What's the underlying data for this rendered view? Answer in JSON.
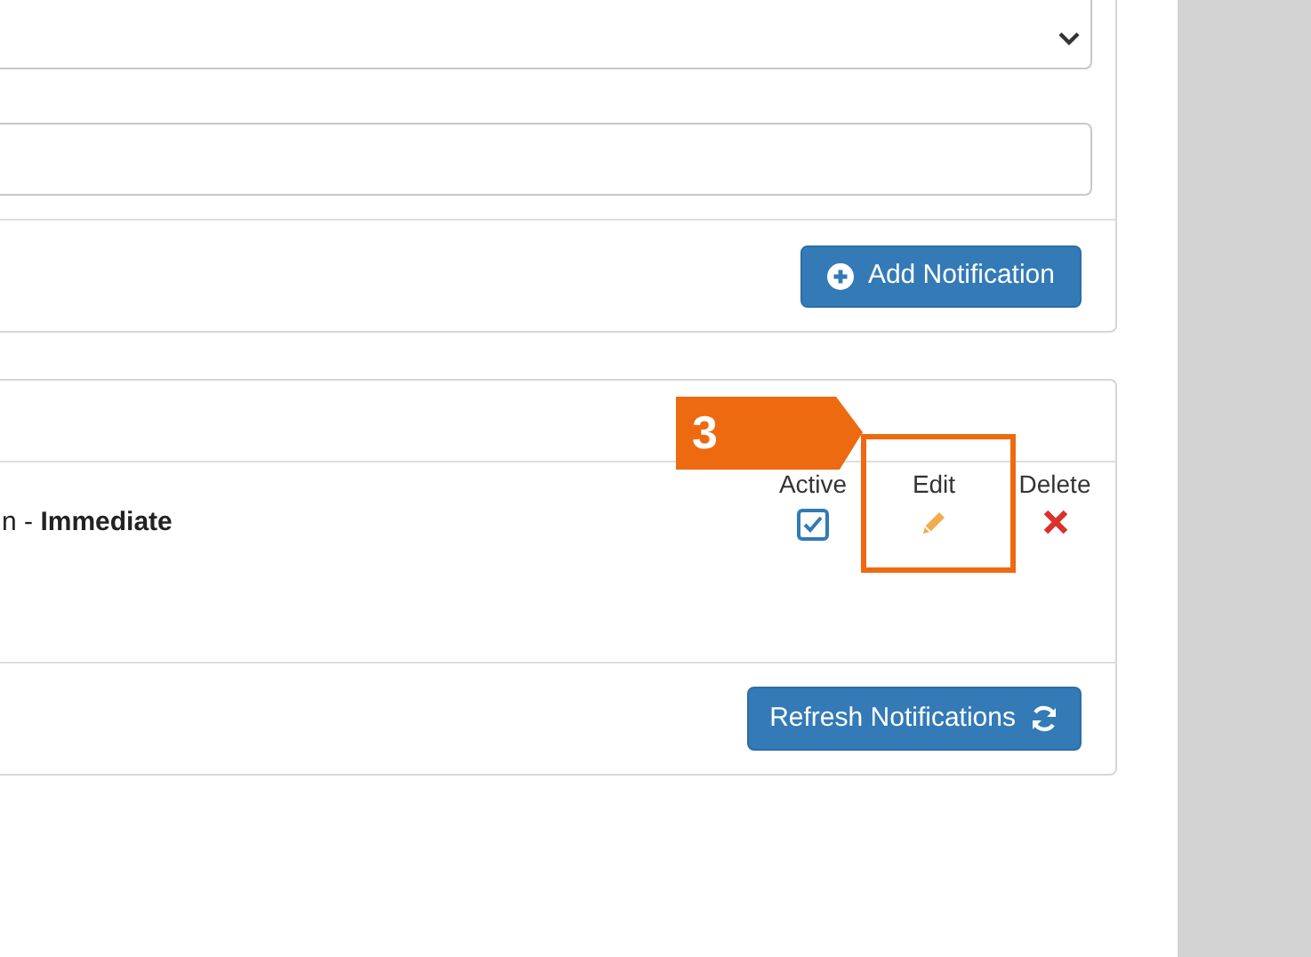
{
  "add_form": {
    "button": "Add Notification"
  },
  "notifications": {
    "columns": [
      "Active",
      "Edit",
      "Delete"
    ],
    "rows": [
      {
        "text": "n - **Immediate**",
        "active": true
      }
    ],
    "button": "Refresh Notifications"
  },
  "annotation": {
    "step": "3"
  }
}
